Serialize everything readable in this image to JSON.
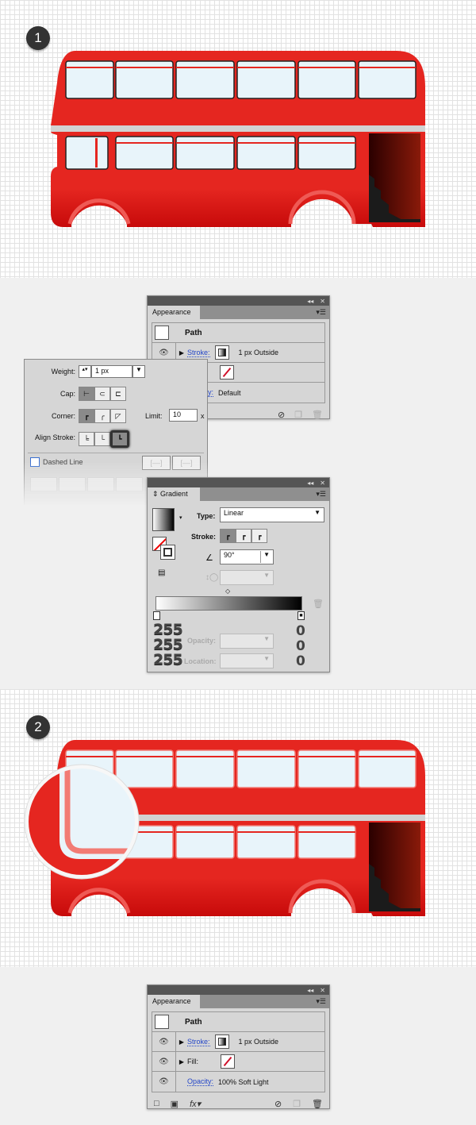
{
  "steps": [
    "1",
    "2"
  ],
  "colors": {
    "bus_red": "#e52620",
    "window": "#e8f4fa",
    "strip": "#d0d0d0",
    "panel": "#d6d6d6",
    "link": "#2346c8"
  },
  "appearance1": {
    "tab": "Appearance",
    "title": "Path",
    "stroke_label": "Stroke:",
    "stroke_value": "1 px  Outside",
    "opacity_label": "Opacity:",
    "opacity_value": "Default"
  },
  "stroke_panel": {
    "weight_label": "Weight:",
    "weight_value": "1 px",
    "cap_label": "Cap:",
    "corner_label": "Corner:",
    "limit_label": "Limit:",
    "limit_value": "10",
    "limit_unit": "x",
    "align_label": "Align Stroke:",
    "align_selected": "outside",
    "dashed_label": "Dashed Line",
    "dashed_checked": false
  },
  "gradient": {
    "tab": "Gradient",
    "type_label": "Type:",
    "type_value": "Linear",
    "stroke_label": "Stroke:",
    "angle_value": "90°",
    "opacity_label": "Opacity:",
    "location_label": "Location:",
    "start_rgb": [
      "255",
      "255",
      "255"
    ],
    "end_rgb": [
      "0",
      "0",
      "0"
    ]
  },
  "appearance2": {
    "tab": "Appearance",
    "title": "Path",
    "stroke_label": "Stroke:",
    "stroke_value": "1 px  Outside",
    "fill_label": "Fill:",
    "opacity_label": "Opacity:",
    "opacity_value": "100% Soft Light",
    "fx_label": "fx"
  }
}
